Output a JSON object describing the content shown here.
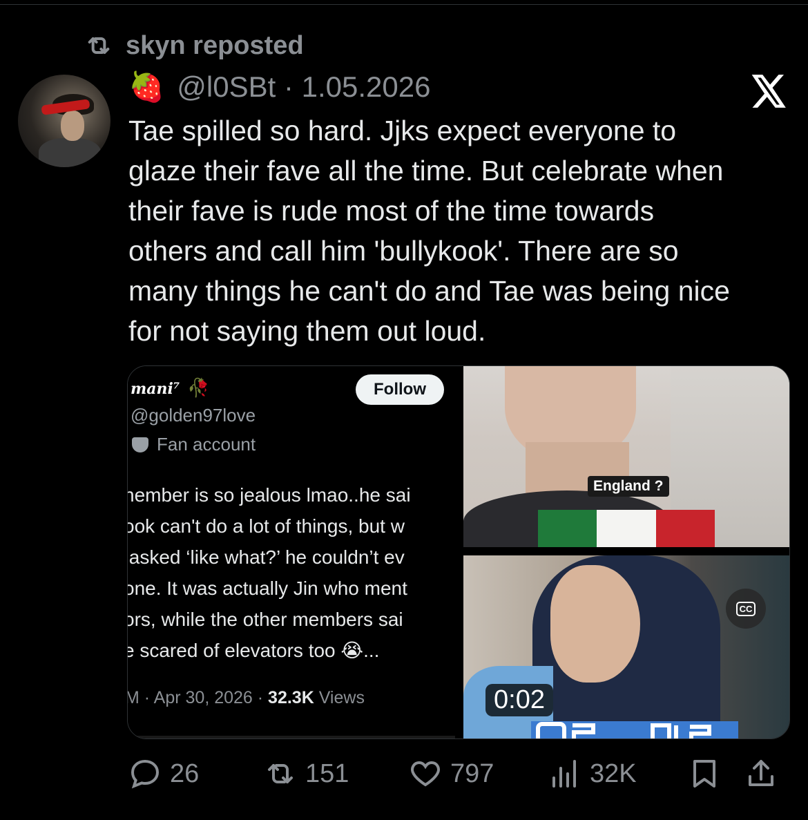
{
  "repost": {
    "label": "skyn reposted"
  },
  "tweet": {
    "emoji": "🍓",
    "handle_date": "@l0SBt · 1.05.2026",
    "text": "Tae spilled so hard. Jjks expect everyone to\nglaze their fave all the time. But celebrate when\ntheir fave is rude most of the time towards\nothers and call him 'bullykook'. There are so\nmany things he can't do and Tae was being nice\nfor not saying them out loud."
  },
  "quoted": {
    "name": "mani⁷",
    "name_emoji": "🥀",
    "handle": "@golden97love",
    "badge": "Fan account",
    "follow_label": "Follow",
    "body": "nember is so jealous lmao..he sai\nook can't do a lot of things, but w\n asked ‘like what?’ he couldn’t ev\none. It was actually Jin who ment\nors, while the other members sai\ne scared of elevators too 😭...",
    "meta_prefix": "M · Apr 30, 2026 · ",
    "views_count": "32.3K",
    "views_label": " Views"
  },
  "media": {
    "caption": "England ?",
    "cc_label": "CC",
    "timestamp": "0:02",
    "flag_colors": [
      "#1f7a3a",
      "#f4f4f2",
      "#c8242c"
    ]
  },
  "actions": {
    "replies": "26",
    "reposts": "151",
    "likes": "797",
    "views": "32K"
  },
  "colors": {
    "background": "#000000",
    "text": "#e7e9ea",
    "muted": "#8b8f94"
  }
}
